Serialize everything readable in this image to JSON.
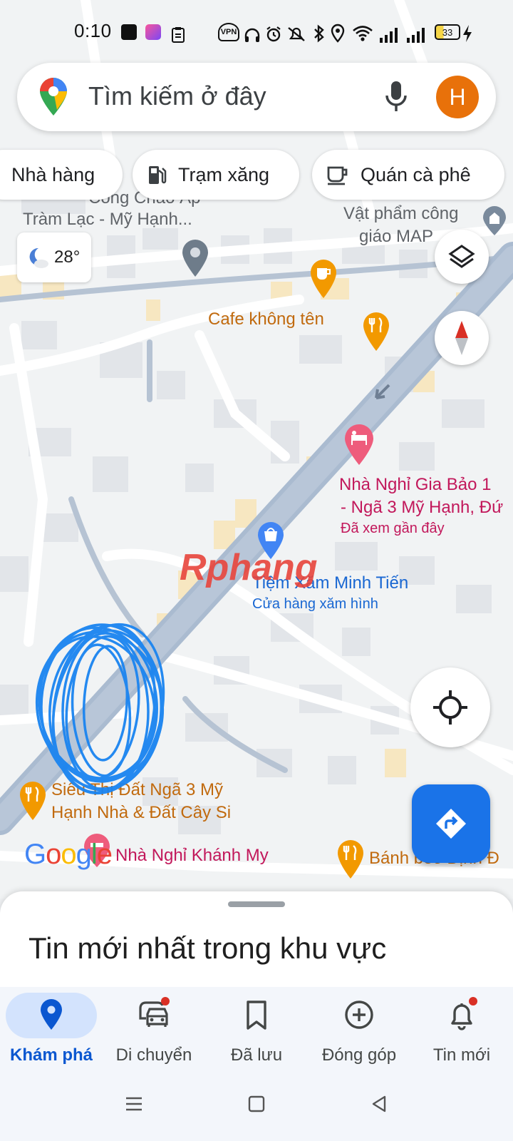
{
  "status_bar": {
    "time": "0:10",
    "app_icons": [
      "bao-moi-icon",
      "lazada-icon",
      "clipboard-icon"
    ],
    "system_icons": [
      "vpn-icon",
      "headset-icon",
      "alarm-icon",
      "mute-icon",
      "bluetooth-icon",
      "location-icon",
      "wifi-icon",
      "signal-icon",
      "signal-icon",
      "battery-icon",
      "charging-icon"
    ],
    "vpn_label": "VPN",
    "battery_level": "33"
  },
  "search": {
    "placeholder": "Tìm kiếm ở đây",
    "avatar_initial": "H"
  },
  "chips": [
    {
      "label": "Nhà hàng"
    },
    {
      "label": "Trạm xăng",
      "icon": "gas-station-icon"
    },
    {
      "label": "Quán cà phê",
      "icon": "coffee-icon"
    }
  ],
  "weather": {
    "temperature": "28°",
    "icon": "night-cloud-icon"
  },
  "map": {
    "labels": {
      "church_area_1": "Cổng Chào Ấp",
      "church_area_2": "Tràm Lạc - Mỹ Hạnh...",
      "religious_1": "Vật phẩm công",
      "religious_2": "giáo MAP",
      "cafe": "Cafe không tên",
      "hotel_1": "Nhà Nghỉ Gia Bảo 1",
      "hotel_2": "- Ngã 3 Mỹ Hạnh, Đứ",
      "hotel_sub": "Đã xem gần đây",
      "tattoo": "Tiệm Xăm Minh Tiến",
      "tattoo_sub": "Cửa hàng xăm hình",
      "supermarket_1": "Siêu Thị Đất Ngã 3 Mỹ",
      "supermarket_2": "Hạnh Nhà & Đất Cây Si",
      "hotel_khanh_my": "Nhà Nghỉ Khánh My",
      "banh_beo": "Bánh bèo Định Đ"
    },
    "watermark": "Rphang",
    "logo": "Google",
    "logo_colors": [
      "#4285F4",
      "#EA4335",
      "#FBBC05",
      "#4285F4",
      "#34A853",
      "#EA4335"
    ]
  },
  "sheet": {
    "title": "Tin mới nhất trong khu vực"
  },
  "bottom_nav": [
    {
      "label": "Khám phá",
      "icon": "explore-pin-icon",
      "active": true
    },
    {
      "label": "Di chuyển",
      "icon": "commute-car-icon",
      "badge": true
    },
    {
      "label": "Đã lưu",
      "icon": "bookmark-icon"
    },
    {
      "label": "Đóng góp",
      "icon": "add-circle-icon"
    },
    {
      "label": "Tin mới",
      "icon": "bell-icon",
      "badge": true
    }
  ],
  "colors": {
    "accent": "#1a73e8",
    "active_pill": "#d3e3fd",
    "active_label": "#0b57d0",
    "road": "#aabbd0",
    "avatar": "#e8710a"
  }
}
